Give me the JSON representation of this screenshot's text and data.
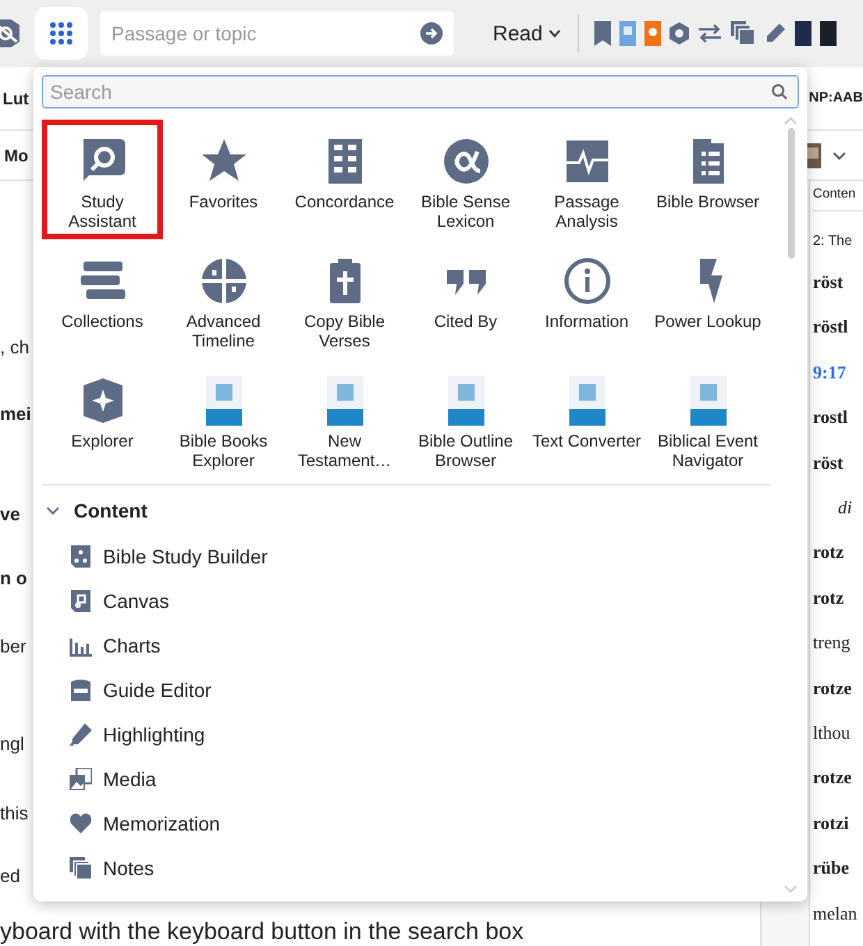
{
  "toolbar": {
    "passage_field": {
      "placeholder": "Passage or topic"
    },
    "read_menu": {
      "label": "Read"
    }
  },
  "left_pane": {
    "tab_label": "Lut",
    "row_label": "Mo",
    "lines": [
      {
        "text": ", ch",
        "kind": "plain"
      },
      {
        "text": "mei",
        "kind": "bold"
      },
      {
        "text": "ve",
        "kind": "bold"
      },
      {
        "text": "n o",
        "kind": "bold"
      },
      {
        "text": "ber",
        "kind": "plain"
      },
      {
        "text": "ngl",
        "kind": "plain"
      },
      {
        "text": "this",
        "kind": "plain"
      },
      {
        "text": "ed",
        "kind": "plain"
      },
      {
        "text": "yboard with the keyboard button in the search box",
        "kind": "plain"
      }
    ]
  },
  "right_pane": {
    "tab_label": "NP:AAB",
    "header": "Conten",
    "subheader": "2: The",
    "lines": [
      {
        "text": "röst",
        "kind": "bold"
      },
      {
        "text": "röstl",
        "kind": "bold"
      },
      {
        "text": "9:17",
        "kind": "link"
      },
      {
        "text": "rostl",
        "kind": "bold"
      },
      {
        "text": "röst",
        "kind": "bold"
      },
      {
        "text": "di",
        "kind": "italic"
      },
      {
        "text": "rotz",
        "kind": "bold"
      },
      {
        "text": "rotz",
        "kind": "bold"
      },
      {
        "text": "treng",
        "kind": "plain"
      },
      {
        "text": "rotze",
        "kind": "bold"
      },
      {
        "text": "lthou",
        "kind": "plain"
      },
      {
        "text": "rotze",
        "kind": "bold"
      },
      {
        "text": "rotzi",
        "kind": "bold"
      },
      {
        "text": "rübe",
        "kind": "bold"
      },
      {
        "text": "melan",
        "kind": "plain"
      }
    ]
  },
  "tools_menu": {
    "search": {
      "placeholder": "Search"
    },
    "tools": [
      {
        "label": "Study Assistant",
        "kind": "glyph",
        "selected": true
      },
      {
        "label": "Favorites",
        "kind": "glyph",
        "selected": false
      },
      {
        "label": "Concordance",
        "kind": "glyph",
        "selected": false
      },
      {
        "label": "Bible Sense Lexicon",
        "kind": "glyph",
        "selected": false
      },
      {
        "label": "Passage Analysis",
        "kind": "glyph",
        "selected": false
      },
      {
        "label": "Bible Browser",
        "kind": "glyph",
        "selected": false
      },
      {
        "label": "Collections",
        "kind": "glyph",
        "selected": false
      },
      {
        "label": "Advanced Timeline",
        "kind": "glyph",
        "selected": false
      },
      {
        "label": "Copy Bible Verses",
        "kind": "glyph",
        "selected": false
      },
      {
        "label": "Cited By",
        "kind": "glyph",
        "selected": false
      },
      {
        "label": "Information",
        "kind": "glyph",
        "selected": false
      },
      {
        "label": "Power Lookup",
        "kind": "glyph",
        "selected": false
      },
      {
        "label": "Explorer",
        "kind": "glyph",
        "selected": false
      },
      {
        "label": "Bible Books Explorer",
        "kind": "cover",
        "selected": false
      },
      {
        "label": "New Testament…",
        "kind": "cover",
        "selected": false
      },
      {
        "label": "Bible Outline Browser",
        "kind": "cover",
        "selected": false
      },
      {
        "label": "Text Converter",
        "kind": "cover",
        "selected": false
      },
      {
        "label": "Biblical Event Navigator",
        "kind": "cover",
        "selected": false
      }
    ],
    "section": {
      "title": "Content",
      "expanded": true,
      "items": [
        {
          "label": "Bible Study Builder"
        },
        {
          "label": "Canvas"
        },
        {
          "label": "Charts"
        },
        {
          "label": "Guide Editor"
        },
        {
          "label": "Highlighting"
        },
        {
          "label": "Media"
        },
        {
          "label": "Memorization"
        },
        {
          "label": "Notes"
        }
      ]
    }
  }
}
